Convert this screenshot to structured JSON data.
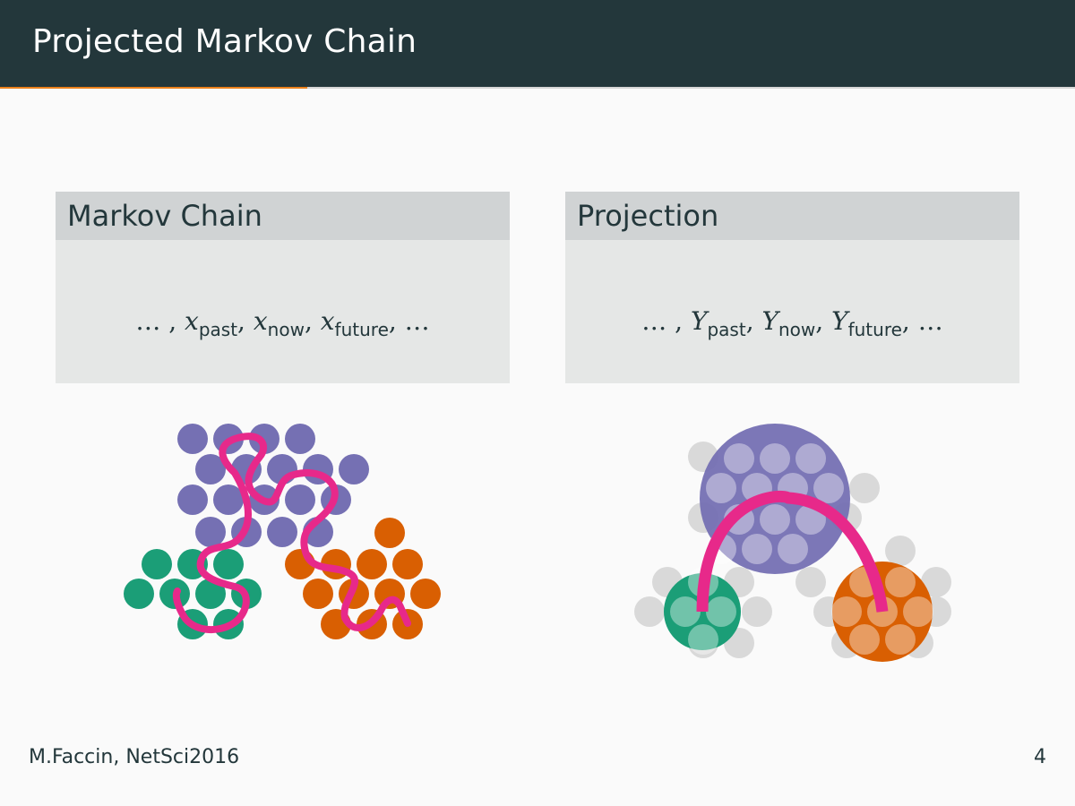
{
  "header": {
    "title": "Projected Markov Chain",
    "progress_fraction": 0.286,
    "progress_color": "#eb811b"
  },
  "blocks": {
    "left": {
      "title": "Markov Chain",
      "formula": {
        "dots_open": "… ,",
        "var": "x",
        "sub_past": "past",
        "sub_now": "now",
        "sub_future": "future",
        "dots_close": ", …"
      }
    },
    "right": {
      "title": "Projection",
      "formula": {
        "dots_open": "… ,",
        "var": "Y",
        "sub_past": "past",
        "sub_now": "now",
        "sub_future": "future",
        "dots_close": ", …"
      }
    }
  },
  "colors": {
    "purple": "#7570b3",
    "green": "#1b9e77",
    "orange": "#d95f02",
    "path": "#e7298a",
    "node_gray": "#d9d9d9"
  },
  "footer": {
    "author": "M.Faccin, NetSci2016",
    "page_number": "4"
  }
}
